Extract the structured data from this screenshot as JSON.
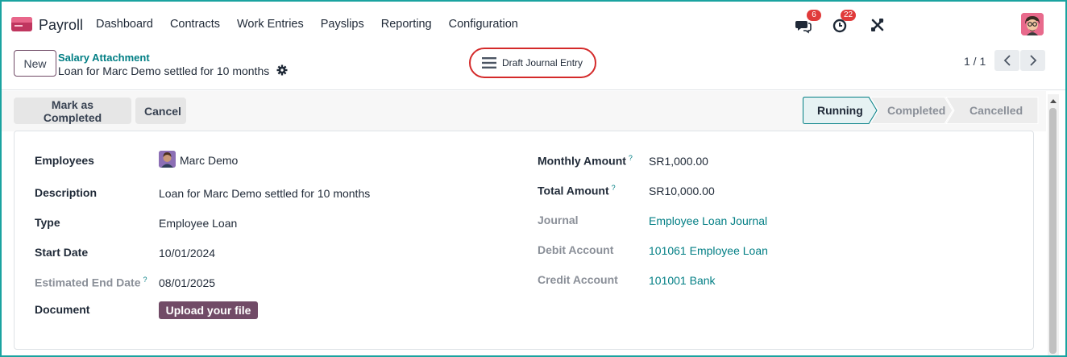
{
  "navbar": {
    "app_name": "Payroll",
    "menu": [
      "Dashboard",
      "Contracts",
      "Work Entries",
      "Payslips",
      "Reporting",
      "Configuration"
    ],
    "messages_badge": "6",
    "activities_badge": "22",
    "icons": [
      "messages-icon",
      "activity-clock-icon",
      "tools-icon",
      "user-avatar"
    ]
  },
  "control_panel": {
    "new_label": "New",
    "breadcrumb_parent": "Salary Attachment",
    "breadcrumb_current": "Loan for Marc Demo settled for 10 months",
    "draft_entry_label": "Draft Journal Entry",
    "pager": "1 / 1"
  },
  "status_bar": {
    "buttons": [
      "Mark as Completed",
      "Cancel"
    ],
    "stages": [
      "Running",
      "Completed",
      "Cancelled"
    ],
    "active_stage": "Running"
  },
  "form": {
    "left": [
      {
        "label": "Employees",
        "value": "Marc Demo"
      },
      {
        "label": "Description",
        "value": "Loan for Marc Demo settled for 10 months"
      },
      {
        "label": "Type",
        "value": "Employee Loan"
      },
      {
        "label": "Start Date",
        "value": "10/01/2024"
      },
      {
        "label": "Estimated End Date",
        "help": "?",
        "value": "08/01/2025"
      },
      {
        "label": "Document",
        "button": "Upload your file"
      }
    ],
    "right": [
      {
        "label": "Monthly Amount",
        "help": "?",
        "value": "SR1,000.00"
      },
      {
        "label": "Total Amount",
        "help": "?",
        "value": "SR10,000.00"
      },
      {
        "label": "Journal",
        "value": "Employee Loan Journal"
      },
      {
        "label": "Debit Account",
        "value": "101061 Employee Loan"
      },
      {
        "label": "Credit Account",
        "value": "101001 Bank"
      }
    ]
  },
  "colors": {
    "brand": "#714b67",
    "link": "#017e84",
    "highlight_ring": "#d42a2a",
    "badge": "#e03a3a",
    "window_border": "#1aa3a0"
  }
}
